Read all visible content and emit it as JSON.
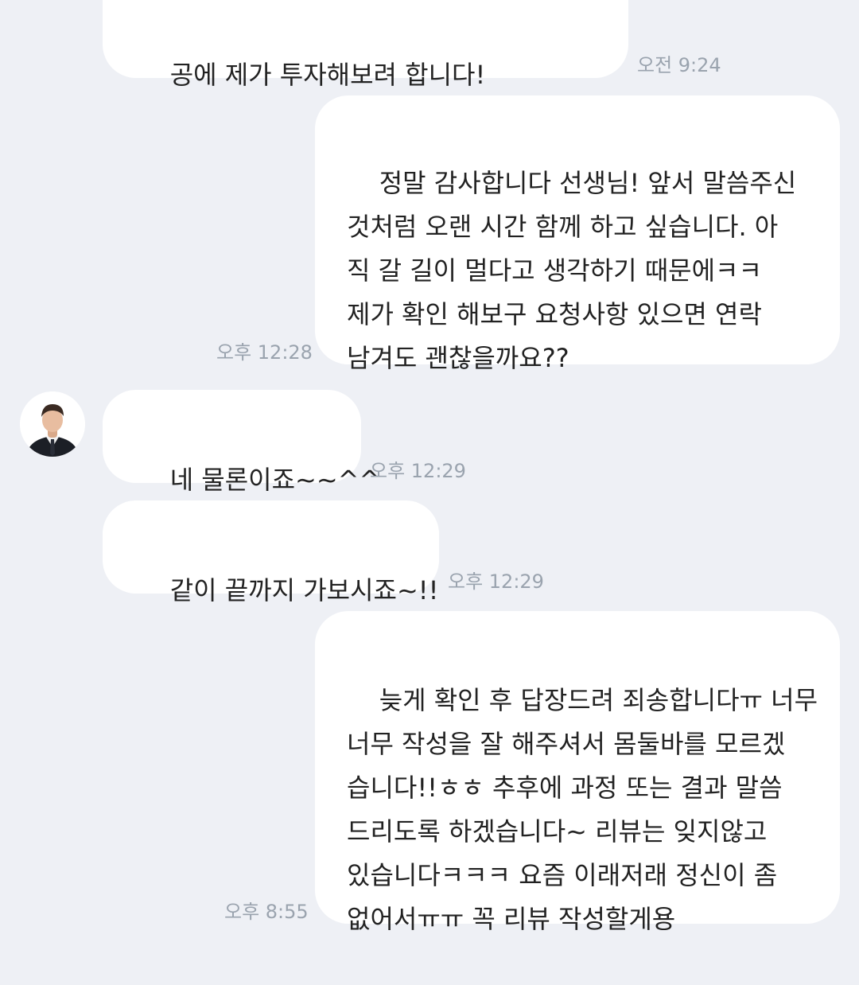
{
  "messages": [
    {
      "id": "m1",
      "sender": "other",
      "text": "공에 제가 투자해보려 합니다!",
      "time": "오전 9:24"
    },
    {
      "id": "m2",
      "sender": "me",
      "text": "정말 감사합니다 선생님! 앞서 말씀주신\n것처럼 오랜 시간 함께 하고 싶습니다. 아\n직 갈 길이 멀다고 생각하기 때문에ㅋㅋ\n제가 확인 해보구 요청사항 있으면 연락\n남겨도 괜찮을까요??",
      "time": "오후 12:28"
    },
    {
      "id": "m3",
      "sender": "other",
      "text": "네 물론이죠~~^^",
      "time": "오후 12:29"
    },
    {
      "id": "m4",
      "sender": "other",
      "text": "같이 끝까지 가보시죠~!!",
      "time": "오후 12:29"
    },
    {
      "id": "m5",
      "sender": "me",
      "text": "늦게 확인 후 답장드려 죄송합니다ㅠ 너무\n너무 작성을 잘 해주셔서 몸둘바를 모르겠\n습니다!!ㅎㅎ 추후에 과정 또는 결과 말씀\n드리도록 하겠습니다~ 리뷰는 잊지않고\n있습니다ㅋㅋㅋ 요즘 이래저래 정신이 좀\n없어서ㅠㅠ 꼭 리뷰 작성할게용",
      "time": "오후 8:55"
    }
  ],
  "colors": {
    "background": "#eef0f5",
    "bubble": "#ffffff",
    "text": "#222222",
    "timestamp": "#9aa3ae"
  }
}
